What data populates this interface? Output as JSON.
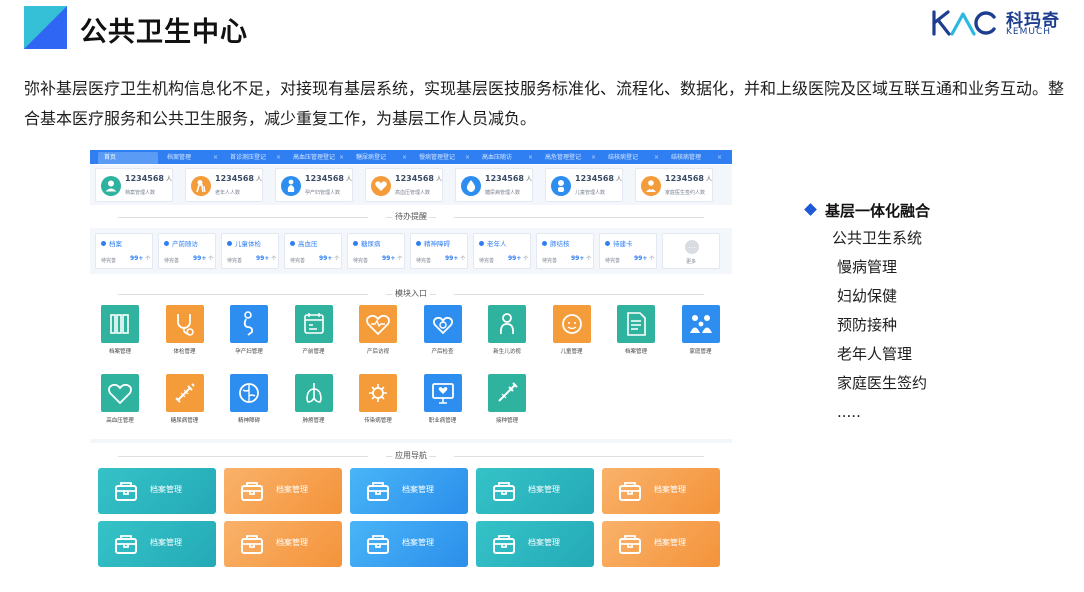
{
  "slide": {
    "title": "公共卫生中心",
    "intro": "弥补基层医疗卫生机构信息化不足，对接现有基层系统，实现基层医技服务标准化、流程化、数据化，并和上级医院及区域互联互通和业务互动。整合基本医疗服务和公共卫生服务，减少重复工作，为基层工作人员减负。"
  },
  "logo": {
    "cn": "科玛奇",
    "en": "KEMUCH",
    "color": "#1d3e90"
  },
  "colors": {
    "accent": "#2f7ff2",
    "teal": "#2fb39f",
    "orange": "#f49b3a",
    "blue": "#2e8ef0"
  },
  "app": {
    "tabs": [
      {
        "label": "首页",
        "active": true
      },
      {
        "label": "档案管理"
      },
      {
        "label": "首诊测压登记"
      },
      {
        "label": "高血压管理登记"
      },
      {
        "label": "糖尿病登记"
      },
      {
        "label": "慢病管理登记"
      },
      {
        "label": "高血压随访"
      },
      {
        "label": "高危管理登记"
      },
      {
        "label": "结核病登记"
      },
      {
        "label": "结核病管理"
      }
    ],
    "stats": [
      {
        "value": "1234568",
        "unit": "人",
        "label": "档案管理人数",
        "color": "#2fb39f",
        "icon": "user-icon"
      },
      {
        "value": "1234568",
        "unit": "人",
        "label": "老年人人数",
        "color": "#f49b3a",
        "icon": "elder-icon"
      },
      {
        "value": "1234568",
        "unit": "人",
        "label": "孕产妇管理人数",
        "color": "#2e8ef0",
        "icon": "mother-icon"
      },
      {
        "value": "1234568",
        "unit": "人",
        "label": "高血压管理人数",
        "color": "#f49b3a",
        "icon": "heart-icon"
      },
      {
        "value": "1234568",
        "unit": "人",
        "label": "糖尿病管理人数",
        "color": "#2e8ef0",
        "icon": "drop-icon"
      },
      {
        "value": "1234568",
        "unit": "人",
        "label": "儿童管理人数",
        "color": "#2e8ef0",
        "icon": "child-icon"
      },
      {
        "value": "1234568",
        "unit": "人",
        "label": "家庭医生签约人数",
        "color": "#f49b3a",
        "icon": "doctor-icon"
      }
    ],
    "reminders_title": "待办提醒",
    "reminders": [
      {
        "name": "档案",
        "sub": "待完善",
        "count": "99+",
        "unit": "个"
      },
      {
        "name": "产前随访",
        "sub": "待完善",
        "count": "99+",
        "unit": "个"
      },
      {
        "name": "儿童体检",
        "sub": "待完善",
        "count": "99+",
        "unit": "个"
      },
      {
        "name": "高血压",
        "sub": "待完善",
        "count": "99+",
        "unit": "个"
      },
      {
        "name": "糖尿病",
        "sub": "待完善",
        "count": "99+",
        "unit": "个"
      },
      {
        "name": "精神障碍",
        "sub": "待完善",
        "count": "99+",
        "unit": "个"
      },
      {
        "name": "老年人",
        "sub": "待完善",
        "count": "99+",
        "unit": "个"
      },
      {
        "name": "肺结核",
        "sub": "待完善",
        "count": "99+",
        "unit": "个"
      },
      {
        "name": "待建卡",
        "sub": "待完善",
        "count": "99+",
        "unit": "个"
      }
    ],
    "more_label": "更多",
    "modules_title": "模块入口",
    "modules": [
      {
        "label": "档案管理",
        "color": "teal",
        "icon": "books-icon"
      },
      {
        "label": "体检管理",
        "color": "orange",
        "icon": "stethoscope-icon"
      },
      {
        "label": "孕产妇管理",
        "color": "blue",
        "icon": "pregnant-icon"
      },
      {
        "label": "产前管理",
        "color": "teal",
        "icon": "calendar-icon"
      },
      {
        "label": "产后访视",
        "color": "orange",
        "icon": "heart-pulse-icon"
      },
      {
        "label": "产后检查",
        "color": "blue",
        "icon": "hearts-icon"
      },
      {
        "label": "新生儿访视",
        "color": "teal",
        "icon": "baby-icon"
      },
      {
        "label": "儿童管理",
        "color": "orange",
        "icon": "kid-face-icon"
      },
      {
        "label": "档案管理",
        "color": "teal",
        "icon": "document-icon"
      },
      {
        "label": "家庭管理",
        "color": "blue",
        "icon": "family-icon"
      },
      {
        "label": "高血压管理",
        "color": "teal",
        "icon": "heart-icon"
      },
      {
        "label": "糖尿病管理",
        "color": "orange",
        "icon": "syringe-icon"
      },
      {
        "label": "精神障碍",
        "color": "blue",
        "icon": "brain-icon"
      },
      {
        "label": "肺痨管理",
        "color": "teal",
        "icon": "lungs-icon"
      },
      {
        "label": "传染病管理",
        "color": "orange",
        "icon": "virus-icon"
      },
      {
        "label": "职业病管理",
        "color": "blue",
        "icon": "monitor-icon"
      },
      {
        "label": "接种管理",
        "color": "teal",
        "icon": "vaccine-icon"
      }
    ],
    "nav_title": "应用导航",
    "nav": [
      {
        "label": "档案管理",
        "color": "teal"
      },
      {
        "label": "档案管理",
        "color": "orange"
      },
      {
        "label": "档案管理",
        "color": "blue"
      },
      {
        "label": "档案管理",
        "color": "teal"
      },
      {
        "label": "档案管理",
        "color": "orange"
      },
      {
        "label": "档案管理",
        "color": "teal"
      },
      {
        "label": "档案管理",
        "color": "orange"
      },
      {
        "label": "档案管理",
        "color": "blue"
      },
      {
        "label": "档案管理",
        "color": "teal"
      },
      {
        "label": "档案管理",
        "color": "orange"
      }
    ]
  },
  "features": {
    "heading": "基层一体化融合",
    "subheading": "公共卫生系统",
    "items": [
      "慢病管理",
      "妇幼保健",
      "预防接种",
      "老年人管理",
      "家庭医生签约",
      "....."
    ]
  }
}
